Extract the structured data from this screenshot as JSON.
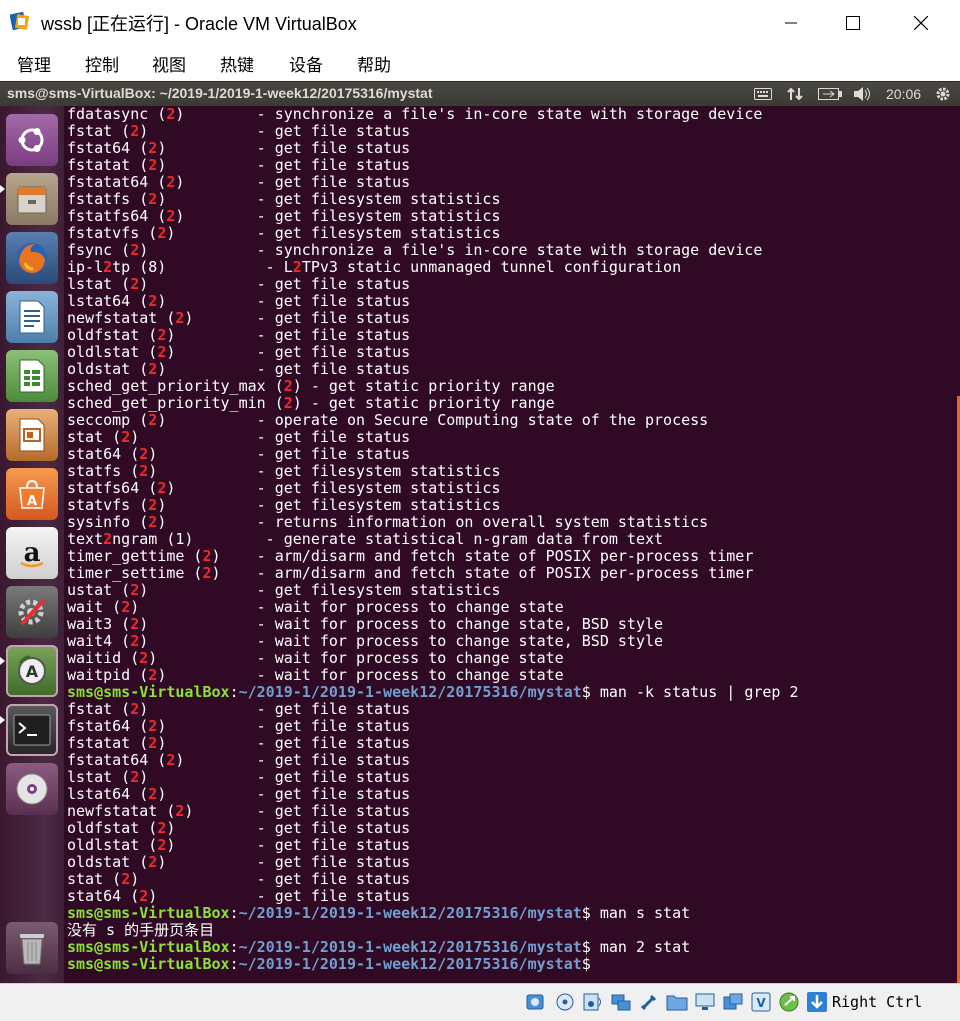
{
  "window": {
    "title": "wssb [正在运行] - Oracle VM VirtualBox",
    "minimize_glyph": "—",
    "maximize_glyph": "☐",
    "close_glyph": "✕"
  },
  "menu": [
    "管理",
    "控制",
    "视图",
    "热键",
    "设备",
    "帮助"
  ],
  "panel": {
    "title": "sms@sms-VirtualBox: ~/2019-1/2019-1-week12/20175316/mystat",
    "clock": "20:06",
    "indicators": [
      "keyboard-icon",
      "network-icon",
      "battery-icon",
      "volume-icon",
      "gear-icon"
    ]
  },
  "launcher": {
    "items": [
      "dash-home-icon",
      "files-icon",
      "firefox-icon",
      "writer-icon",
      "calc-icon",
      "impress-icon",
      "software-center-icon",
      "amazon-icon",
      "system-settings-icon",
      "software-updater-icon",
      "terminal-icon",
      "dvd-icon"
    ],
    "trash": "trash-icon"
  },
  "terminal": {
    "lines": [
      [
        [
          "fdatasync (",
          ""
        ],
        [
          "2",
          "hl"
        ],
        [
          ")        - synchronize a file's in-core state with storage device",
          ""
        ]
      ],
      [
        [
          "fstat (",
          ""
        ],
        [
          "2",
          "hl"
        ],
        [
          ")            - get file status",
          ""
        ]
      ],
      [
        [
          "fstat64 (",
          ""
        ],
        [
          "2",
          "hl"
        ],
        [
          ")          - get file status",
          ""
        ]
      ],
      [
        [
          "fstatat (",
          ""
        ],
        [
          "2",
          "hl"
        ],
        [
          ")          - get file status",
          ""
        ]
      ],
      [
        [
          "fstatat64 (",
          ""
        ],
        [
          "2",
          "hl"
        ],
        [
          ")        - get file status",
          ""
        ]
      ],
      [
        [
          "fstatfs (",
          ""
        ],
        [
          "2",
          "hl"
        ],
        [
          ")          - get filesystem statistics",
          ""
        ]
      ],
      [
        [
          "fstatfs64 (",
          ""
        ],
        [
          "2",
          "hl"
        ],
        [
          ")        - get filesystem statistics",
          ""
        ]
      ],
      [
        [
          "fstatvfs (",
          ""
        ],
        [
          "2",
          "hl"
        ],
        [
          ")         - get filesystem statistics",
          ""
        ]
      ],
      [
        [
          "fsync (",
          ""
        ],
        [
          "2",
          "hl"
        ],
        [
          ")            - synchronize a file's in-core state with storage device",
          ""
        ]
      ],
      [
        [
          "ip-l",
          ""
        ],
        [
          "2",
          "hl"
        ],
        [
          "tp (8)           - L",
          ""
        ],
        [
          "2",
          "hl"
        ],
        [
          "TPv3 static unmanaged tunnel configuration",
          ""
        ]
      ],
      [
        [
          "lstat (",
          ""
        ],
        [
          "2",
          "hl"
        ],
        [
          ")            - get file status",
          ""
        ]
      ],
      [
        [
          "lstat64 (",
          ""
        ],
        [
          "2",
          "hl"
        ],
        [
          ")          - get file status",
          ""
        ]
      ],
      [
        [
          "newfstatat (",
          ""
        ],
        [
          "2",
          "hl"
        ],
        [
          ")       - get file status",
          ""
        ]
      ],
      [
        [
          "oldfstat (",
          ""
        ],
        [
          "2",
          "hl"
        ],
        [
          ")         - get file status",
          ""
        ]
      ],
      [
        [
          "oldlstat (",
          ""
        ],
        [
          "2",
          "hl"
        ],
        [
          ")         - get file status",
          ""
        ]
      ],
      [
        [
          "oldstat (",
          ""
        ],
        [
          "2",
          "hl"
        ],
        [
          ")          - get file status",
          ""
        ]
      ],
      [
        [
          "sched_get_priority_max (",
          ""
        ],
        [
          "2",
          "hl"
        ],
        [
          ") - get static priority range",
          ""
        ]
      ],
      [
        [
          "sched_get_priority_min (",
          ""
        ],
        [
          "2",
          "hl"
        ],
        [
          ") - get static priority range",
          ""
        ]
      ],
      [
        [
          "seccomp (",
          ""
        ],
        [
          "2",
          "hl"
        ],
        [
          ")          - operate on Secure Computing state of the process",
          ""
        ]
      ],
      [
        [
          "stat (",
          ""
        ],
        [
          "2",
          "hl"
        ],
        [
          ")             - get file status",
          ""
        ]
      ],
      [
        [
          "stat64 (",
          ""
        ],
        [
          "2",
          "hl"
        ],
        [
          ")           - get file status",
          ""
        ]
      ],
      [
        [
          "statfs (",
          ""
        ],
        [
          "2",
          "hl"
        ],
        [
          ")           - get filesystem statistics",
          ""
        ]
      ],
      [
        [
          "statfs64 (",
          ""
        ],
        [
          "2",
          "hl"
        ],
        [
          ")         - get filesystem statistics",
          ""
        ]
      ],
      [
        [
          "statvfs (",
          ""
        ],
        [
          "2",
          "hl"
        ],
        [
          ")          - get filesystem statistics",
          ""
        ]
      ],
      [
        [
          "sysinfo (",
          ""
        ],
        [
          "2",
          "hl"
        ],
        [
          ")          - returns information on overall system statistics",
          ""
        ]
      ],
      [
        [
          "text",
          ""
        ],
        [
          "2",
          "hl"
        ],
        [
          "ngram (1)        - generate statistical n-gram data from text",
          ""
        ]
      ],
      [
        [
          "timer_gettime (",
          ""
        ],
        [
          "2",
          "hl"
        ],
        [
          ")    - arm/disarm and fetch state of POSIX per-process timer",
          ""
        ]
      ],
      [
        [
          "timer_settime (",
          ""
        ],
        [
          "2",
          "hl"
        ],
        [
          ")    - arm/disarm and fetch state of POSIX per-process timer",
          ""
        ]
      ],
      [
        [
          "ustat (",
          ""
        ],
        [
          "2",
          "hl"
        ],
        [
          ")            - get filesystem statistics",
          ""
        ]
      ],
      [
        [
          "wait (",
          ""
        ],
        [
          "2",
          "hl"
        ],
        [
          ")             - wait for process to change state",
          ""
        ]
      ],
      [
        [
          "wait3 (",
          ""
        ],
        [
          "2",
          "hl"
        ],
        [
          ")            - wait for process to change state, BSD style",
          ""
        ]
      ],
      [
        [
          "wait4 (",
          ""
        ],
        [
          "2",
          "hl"
        ],
        [
          ")            - wait for process to change state, BSD style",
          ""
        ]
      ],
      [
        [
          "waitid (",
          ""
        ],
        [
          "2",
          "hl"
        ],
        [
          ")           - wait for process to change state",
          ""
        ]
      ],
      [
        [
          "waitpid (",
          ""
        ],
        [
          "2",
          "hl"
        ],
        [
          ")          - wait for process to change state",
          ""
        ]
      ],
      [
        [
          "sms@sms-VirtualBox",
          "pu"
        ],
        [
          ":",
          ""
        ],
        [
          "~/2019-1/2019-1-week12/20175316/mystat",
          "pp"
        ],
        [
          "$ man -k status | grep 2",
          ""
        ]
      ],
      [
        [
          "fstat (",
          ""
        ],
        [
          "2",
          "hl"
        ],
        [
          ")            - get file status",
          ""
        ]
      ],
      [
        [
          "fstat64 (",
          ""
        ],
        [
          "2",
          "hl"
        ],
        [
          ")          - get file status",
          ""
        ]
      ],
      [
        [
          "fstatat (",
          ""
        ],
        [
          "2",
          "hl"
        ],
        [
          ")          - get file status",
          ""
        ]
      ],
      [
        [
          "fstatat64 (",
          ""
        ],
        [
          "2",
          "hl"
        ],
        [
          ")        - get file status",
          ""
        ]
      ],
      [
        [
          "lstat (",
          ""
        ],
        [
          "2",
          "hl"
        ],
        [
          ")            - get file status",
          ""
        ]
      ],
      [
        [
          "lstat64 (",
          ""
        ],
        [
          "2",
          "hl"
        ],
        [
          ")          - get file status",
          ""
        ]
      ],
      [
        [
          "newfstatat (",
          ""
        ],
        [
          "2",
          "hl"
        ],
        [
          ")       - get file status",
          ""
        ]
      ],
      [
        [
          "oldfstat (",
          ""
        ],
        [
          "2",
          "hl"
        ],
        [
          ")         - get file status",
          ""
        ]
      ],
      [
        [
          "oldlstat (",
          ""
        ],
        [
          "2",
          "hl"
        ],
        [
          ")         - get file status",
          ""
        ]
      ],
      [
        [
          "oldstat (",
          ""
        ],
        [
          "2",
          "hl"
        ],
        [
          ")          - get file status",
          ""
        ]
      ],
      [
        [
          "stat (",
          ""
        ],
        [
          "2",
          "hl"
        ],
        [
          ")             - get file status",
          ""
        ]
      ],
      [
        [
          "stat64 (",
          ""
        ],
        [
          "2",
          "hl"
        ],
        [
          ")           - get file status",
          ""
        ]
      ],
      [
        [
          "sms@sms-VirtualBox",
          "pu"
        ],
        [
          ":",
          ""
        ],
        [
          "~/2019-1/2019-1-week12/20175316/mystat",
          "pp"
        ],
        [
          "$ man s stat",
          ""
        ]
      ],
      [
        [
          "没有 s 的手册页条目",
          ""
        ]
      ],
      [
        [
          "sms@sms-VirtualBox",
          "pu"
        ],
        [
          ":",
          ""
        ],
        [
          "~/2019-1/2019-1-week12/20175316/mystat",
          "pp"
        ],
        [
          "$ man 2 stat",
          ""
        ]
      ],
      [
        [
          "sms@sms-VirtualBox",
          "pu"
        ],
        [
          ":",
          ""
        ],
        [
          "~/2019-1/2019-1-week12/20175316/mystat",
          "pp"
        ],
        [
          "$ ",
          ""
        ]
      ]
    ]
  },
  "statusbar": {
    "icons": [
      "hard-disk-icon",
      "optical-drive-icon",
      "audio-icon",
      "network-adapter-icon",
      "usb-icon",
      "shared-folders-icon",
      "display-icon",
      "video-capture-icon",
      "virtualization-icon",
      "mouse-integration-icon",
      "host-key-arrow-icon"
    ],
    "host_key": "Right Ctrl"
  }
}
